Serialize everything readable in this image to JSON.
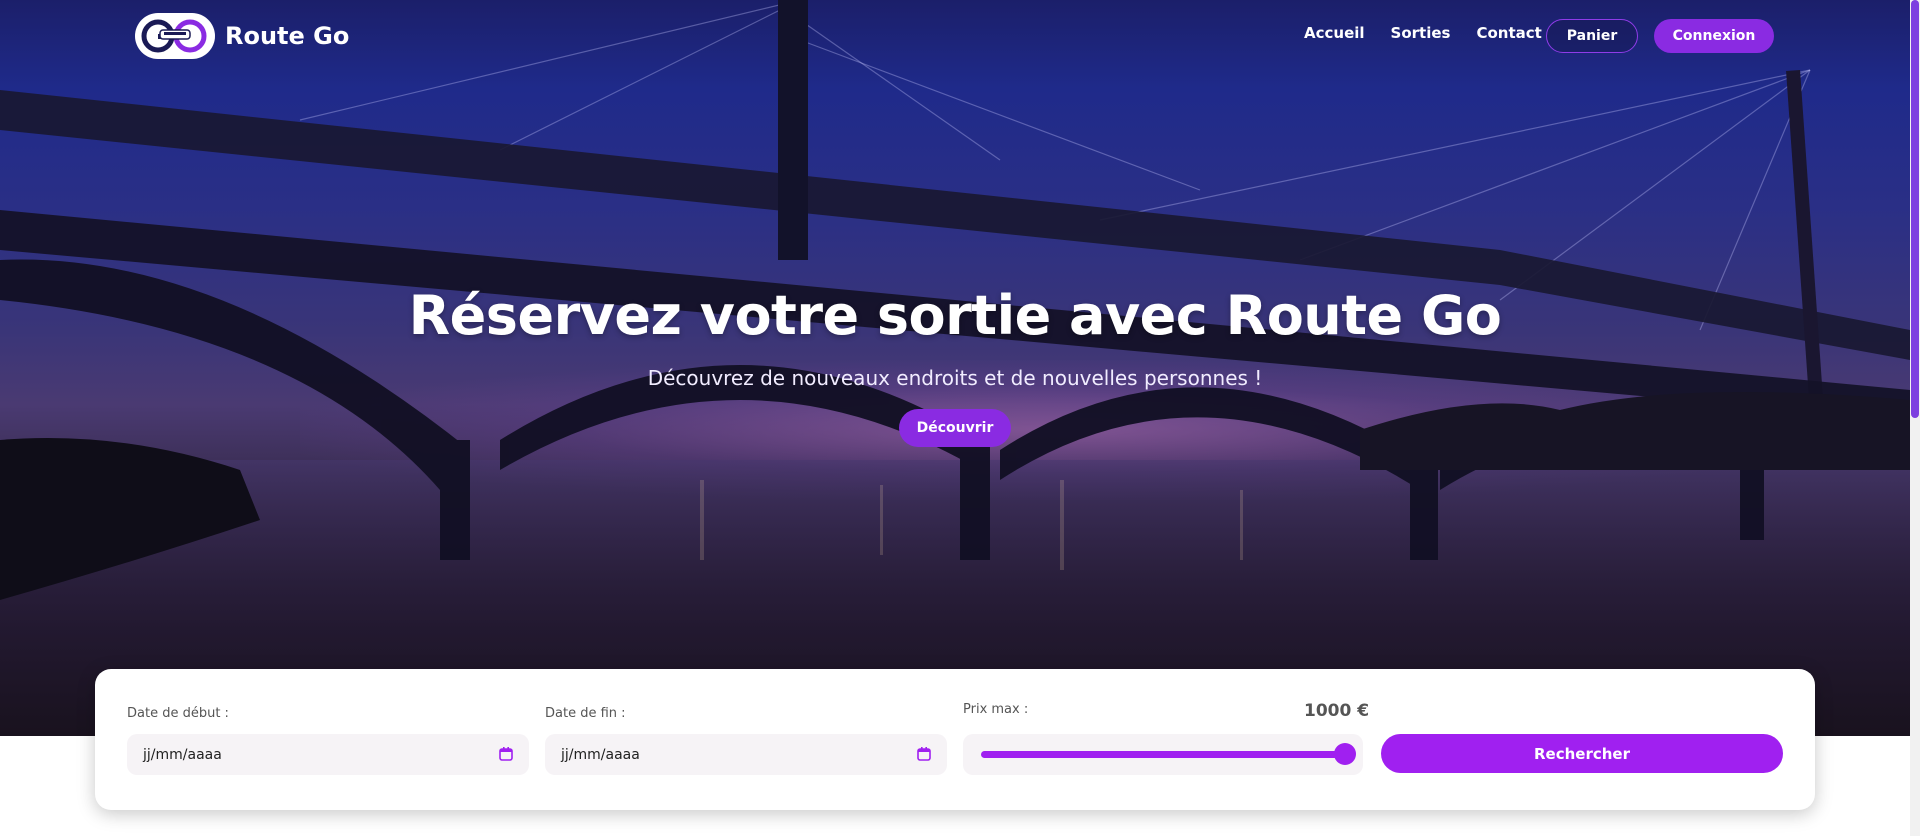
{
  "brand": {
    "name": "Route Go",
    "accent": "#8a2be2"
  },
  "nav": {
    "links": [
      "Accueil",
      "Sorties",
      "Contact"
    ],
    "cart_label": "Panier",
    "login_label": "Connexion"
  },
  "hero": {
    "title": "Réservez votre sortie avec Route Go",
    "subtitle": "Découvrez de nouveaux endroits et de nouvelles personnes !",
    "cta_label": "Découvrir"
  },
  "search": {
    "start_label": "Date de début :",
    "start_placeholder": "jj/mm/aaaa",
    "end_label": "Date de fin :",
    "end_placeholder": "jj/mm/aaaa",
    "price_label": "Prix max :",
    "price_value": "1000 €",
    "slider_fraction": 1.0,
    "submit_label": "Rechercher"
  },
  "icons": [
    "calendar-icon",
    "logo-icon"
  ]
}
